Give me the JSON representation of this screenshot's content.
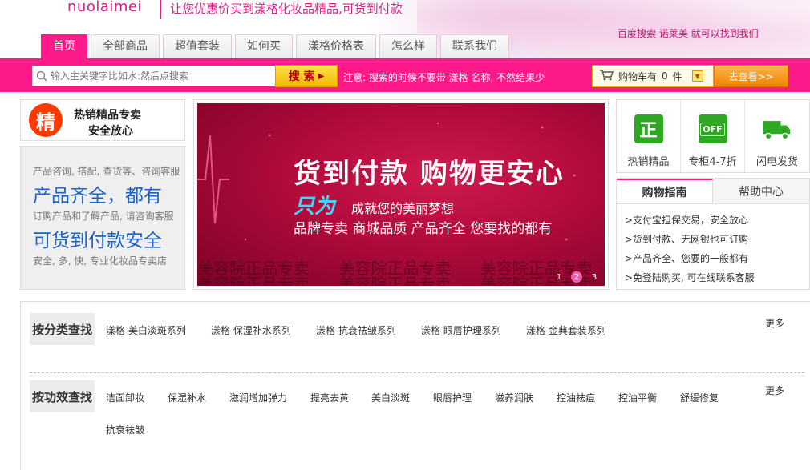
{
  "header": {
    "logo": "nuolaimei",
    "slogan": "让您优惠价买到漾格化妆品精品,可货到付款",
    "tip": "百度搜索  诺莱美  就可以找到我们"
  },
  "nav": {
    "tabs": [
      "首页",
      "全部商品",
      "超值套装",
      "如何买",
      "漾格价格表",
      "怎么样",
      "联系我们"
    ]
  },
  "search": {
    "placeholder": "输入主关键字比如水:然后点搜索",
    "button_label": "搜 索",
    "note": "注意: 搜索的时候不要带  漾格  名称, 不然结果少"
  },
  "cart": {
    "label": "购物车有",
    "count": "0",
    "unit": "件",
    "view_label": "去查看>>"
  },
  "promo": {
    "badge": "精",
    "line1": "热销精品专卖",
    "line2": "安全放心"
  },
  "info": {
    "s1": "产品咨询, 搭配, 查货等、咨询客服",
    "b1": "产品齐全，都有",
    "s2": "订购产品和了解产品, 请咨询客服",
    "b2": "可货到付款安全",
    "s3": "安全, 多, 快, 专业化妆品专卖店"
  },
  "banner": {
    "headline": "货到付款 购物更安心",
    "zhiwei": "只为",
    "dream": "成就您的美丽梦想",
    "sub": "品牌专卖   商城品质   产品齐全   您要找的都有",
    "watermark": "美容院正品专卖   美容院正品专卖   美容院正品专卖",
    "pages": [
      "1",
      "2",
      "3"
    ],
    "active_page": "2"
  },
  "features": [
    {
      "icon": "正",
      "label": "热销精品"
    },
    {
      "icon": "OFF",
      "label": "专柜4-7折"
    },
    {
      "icon": "truck",
      "label": "闪电发货"
    }
  ],
  "guide": {
    "tabs": [
      "购物指南",
      "帮助中心"
    ],
    "items": [
      ">支付宝担保交易，安全放心",
      ">货到付款、无网银也可订购",
      ">产品齐全、您要的一般都有",
      ">免登陆购买, 可在线联系客服"
    ]
  },
  "categories": {
    "by_category": {
      "label": "按分类查找",
      "items": [
        "漾格  美白淡斑系列",
        "漾格  保湿补水系列",
        "漾格  抗衰祛皱系列",
        "漾格  眼唇护理系列",
        "漾格  金典套装系列"
      ],
      "more": "更多"
    },
    "by_function": {
      "label": "按功效查找",
      "items": [
        "洁面卸妆",
        "保湿补水",
        "滋润增加弹力",
        "提亮去黄",
        "美白淡斑",
        "眼唇护理",
        "滋养润肤",
        "控油祛痘",
        "控油平衡",
        "舒缓修复",
        "抗衰祛皱"
      ],
      "more": "更多"
    }
  },
  "colors": {
    "brand": "#ff1a8c",
    "link_blue": "#1b63c8",
    "feature_green": "#2ea822"
  }
}
